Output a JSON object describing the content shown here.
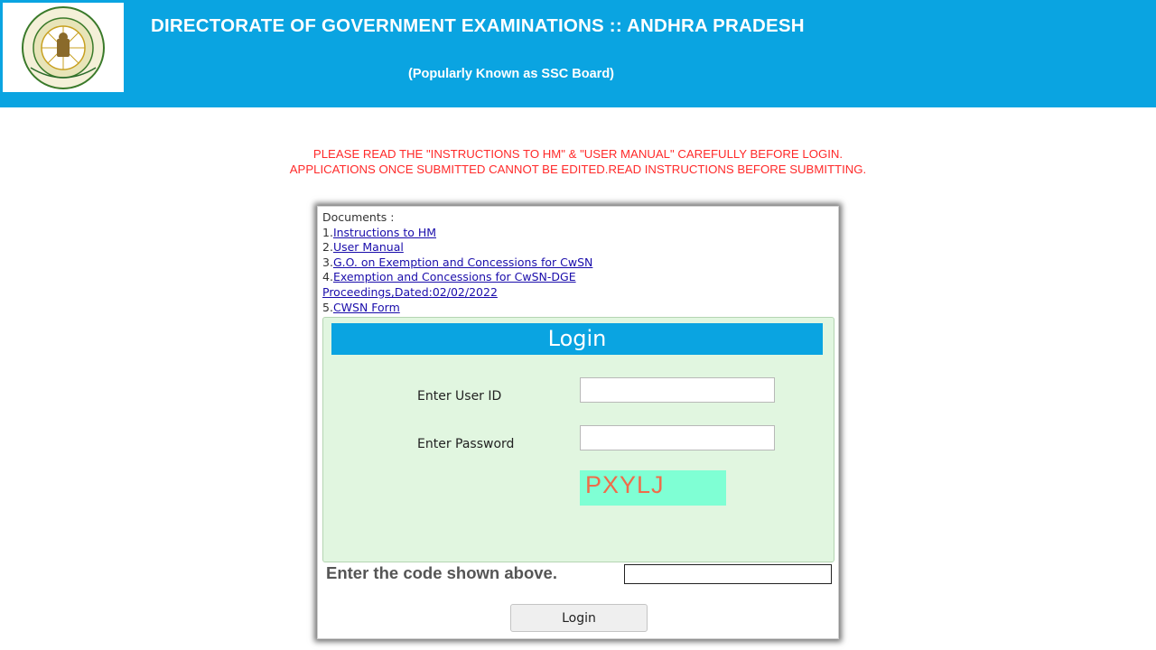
{
  "header": {
    "title": "DIRECTORATE OF GOVERNMENT EXAMINATIONS :: ANDHRA PRADESH",
    "subtitle": "(Popularly Known as SSC Board)",
    "logo_icon": "andhra-pradesh-emblem-icon",
    "background_color": "#0aa4e1"
  },
  "notice": {
    "line1": "PLEASE READ THE \"INSTRUCTIONS TO HM\" & \"USER MANUAL\" CAREFULLY BEFORE LOGIN.",
    "line2": "APPLICATIONS ONCE SUBMITTED CANNOT BE EDITED.READ INSTRUCTIONS BEFORE SUBMITTING.",
    "color": "#ff2a2a"
  },
  "documents": {
    "heading": "Documents :",
    "items": [
      {
        "num": "1.",
        "label": "Instructions to HM"
      },
      {
        "num": "2.",
        "label": "User Manual"
      },
      {
        "num": "3.",
        "label": "G.O. on Exemption and Concessions for CwSN"
      },
      {
        "num": "4.",
        "label": "Exemption and Concessions for CwSN-DGE",
        "label_cont": "Proceedings,Dated:02/02/2022"
      },
      {
        "num": "5.",
        "label": "CWSN Form"
      }
    ]
  },
  "login": {
    "title": "Login",
    "user_label": "Enter User ID",
    "user_value": "",
    "password_label": "Enter Password",
    "password_value": "",
    "captcha_text": "PXYLJ",
    "code_label": "Enter the code shown above.",
    "code_value": "",
    "button_label": "Login",
    "box_color": "#e1f6e0",
    "captcha_bg": "#7fffd4"
  }
}
